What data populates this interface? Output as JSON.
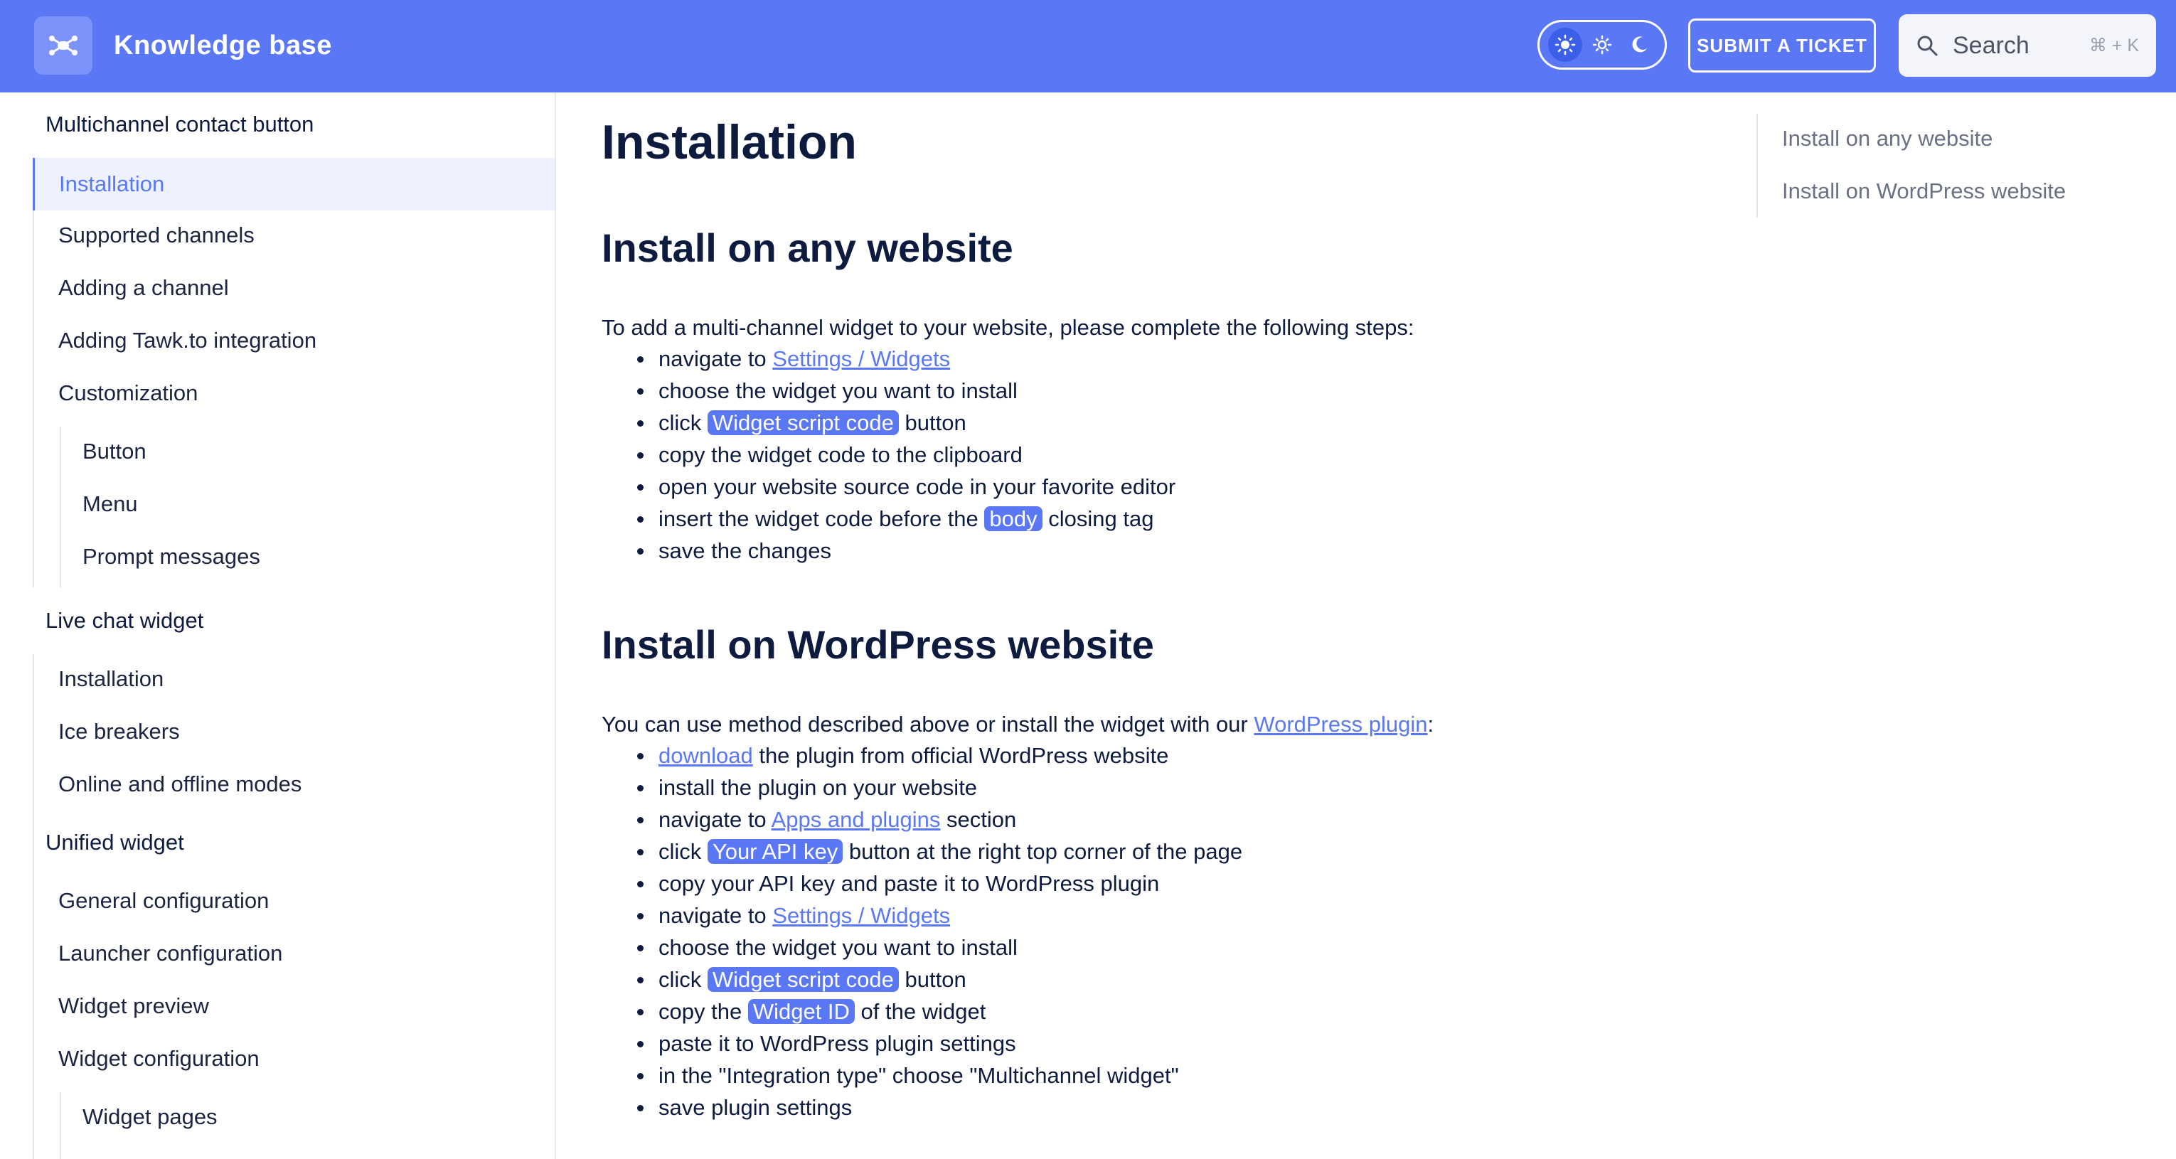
{
  "header": {
    "title": "Knowledge base",
    "submit_ticket": "SUBMIT A TICKET",
    "search_placeholder": "Search",
    "search_shortcut": "⌘ + K",
    "theme_modes": [
      "light",
      "auto",
      "dark"
    ],
    "active_theme": "light"
  },
  "sidebar": {
    "groups": [
      {
        "title": "Multichannel contact button",
        "items": [
          "Installation",
          "Supported channels",
          "Adding a channel",
          "Adding Tawk.to integration",
          "Customization"
        ],
        "subitems": [
          "Button",
          "Menu",
          "Prompt messages"
        ]
      },
      {
        "title": "Live chat widget",
        "items": [
          "Installation",
          "Ice breakers",
          "Online and offline modes"
        ]
      },
      {
        "title": "Unified widget",
        "items": [
          "General configuration",
          "Launcher configuration",
          "Widget preview",
          "Widget configuration"
        ],
        "subitems": [
          "Widget pages"
        ]
      }
    ],
    "active_item": "Installation"
  },
  "main": {
    "title": "Installation",
    "section1": {
      "heading": "Install on any website",
      "intro": "To add a multi-channel widget to your website, please complete the following steps:",
      "steps": {
        "s1_pre": "navigate to ",
        "s1_link": "Settings / Widgets",
        "s2": "choose the widget you want to install",
        "s3_pre": "click ",
        "s3_code": "Widget script code",
        "s3_post": " button",
        "s4": "copy the widget code to the clipboard",
        "s5": "open your website source code in your favorite editor",
        "s6_pre": "insert the widget code before the ",
        "s6_code": "body",
        "s6_post": " closing tag",
        "s7": "save the changes"
      }
    },
    "section2": {
      "heading": "Install on WordPress website",
      "intro_pre": "You can use method described above or install the widget with our ",
      "intro_link": "WordPress plugin",
      "intro_post": ":",
      "steps": {
        "s1_link": "download",
        "s1_post": " the plugin from official WordPress website",
        "s2": "install the plugin on your website",
        "s3_pre": "navigate to ",
        "s3_link": "Apps and plugins",
        "s3_post": " section",
        "s4_pre": "click ",
        "s4_code": "Your API key",
        "s4_post": " button at the right top corner of the page",
        "s5": "copy your API key and paste it to WordPress plugin",
        "s6_pre": "navigate to ",
        "s6_link": "Settings / Widgets",
        "s7": "choose the widget you want to install",
        "s8_pre": "click ",
        "s8_code": "Widget script code",
        "s8_post": " button",
        "s9_pre": "copy the ",
        "s9_code": "Widget ID",
        "s9_post": " of the widget",
        "s10": "paste it to WordPress plugin settings",
        "s11": "in the \"Integration type\" choose \"Multichannel widget\"",
        "s12": "save plugin settings"
      }
    }
  },
  "toc": {
    "items": [
      "Install on any website",
      "Install on WordPress website"
    ]
  },
  "colors": {
    "header_bg": "#5a78f5",
    "accent": "#5a78f5",
    "text": "#0d1b3e"
  }
}
